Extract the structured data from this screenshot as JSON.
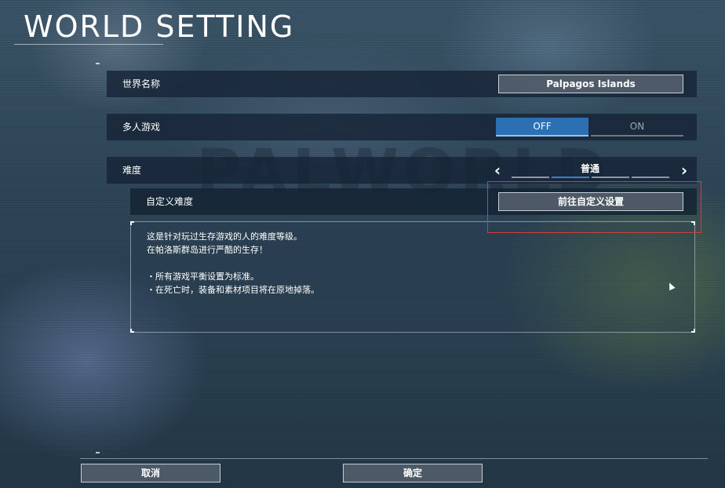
{
  "header": {
    "title": "WORLD SETTING"
  },
  "settings": {
    "world_name": {
      "label": "世界名称",
      "value": "Palpagos Islands"
    },
    "multiplayer": {
      "label": "多人游戏",
      "off_label": "OFF",
      "on_label": "ON",
      "selected": "OFF"
    },
    "difficulty": {
      "label": "难度",
      "value": "普通",
      "prev_icon": "chevron-left-icon",
      "next_icon": "chevron-right-icon"
    },
    "custom_difficulty": {
      "label": "自定义难度",
      "button_label": "前往自定义设置"
    }
  },
  "description": {
    "line1": "这是针对玩过生存游戏的人的难度等级。",
    "line2": "在帕洛斯群岛进行严酷的生存！",
    "bullet1": "・所有游戏平衡设置为标准。",
    "bullet2": "・在死亡时，装备和素材项目将在原地掉落。"
  },
  "footer": {
    "cancel_label": "取消",
    "confirm_label": "确定"
  },
  "colors": {
    "accent": "#2c70b3",
    "highlight": "#d83b3b",
    "panel": "#14233480"
  }
}
